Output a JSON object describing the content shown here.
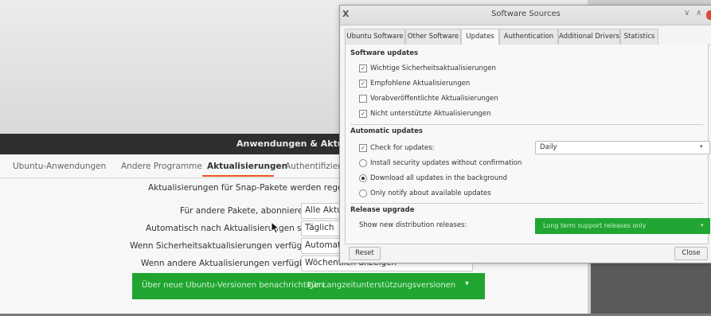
{
  "background_window": {
    "title": "Anwendungen & Aktualisierungen",
    "tabs": [
      "Ubuntu-Anwendungen",
      "Andere Programme",
      "Aktualisierungen",
      "Authentifizierung"
    ],
    "snap_note": "Aktualisierungen für Snap-Pakete werden regelmäßig geprüft",
    "rows": [
      {
        "label": "Für andere Pakete, abonnieren Sie:",
        "value": "Alle Aktualisierungen"
      },
      {
        "label": "Automatisch nach Aktualisierungen suchen:",
        "value": "Täglich"
      },
      {
        "label": "Wenn Sicherheitsaktualisierungen verfügbar sind:",
        "value": "Automatisch herunterladen"
      },
      {
        "label": "Wenn andere Aktualisierungen verfügbar sind:",
        "value": "Wöchentlich anzeigen"
      }
    ],
    "release_row": {
      "label": "Über neue Ubuntu-Versionen benachrichtigen:",
      "value": "Für Langzeitunterstützungsversionen",
      "color": "#1fa530"
    }
  },
  "dialog": {
    "title": "Software Sources",
    "tabs": [
      "Ubuntu Software",
      "Other Software",
      "Updates",
      "Authentication",
      "Additional Drivers",
      "Statistics"
    ],
    "active_tab": "Updates",
    "software_updates": {
      "heading": "Software updates",
      "items": [
        {
          "label": "Wichtige Sicherheitsaktualisierungen",
          "checked": true,
          "check": "✓"
        },
        {
          "label": "Empfohlene Aktualisierungen",
          "checked": true,
          "check": "✓"
        },
        {
          "label": "Vorabveröffentlichte Aktualisierungen",
          "checked": false,
          "check": ""
        },
        {
          "label": "Nicht unterstützte Aktualisierungen",
          "checked": true,
          "check": "✓"
        }
      ]
    },
    "automatic_updates": {
      "heading": "Automatic updates",
      "check_label": "Check for updates:",
      "check_mark": "✓",
      "interval": "Daily",
      "options": [
        {
          "label": "Install security updates without confirmation",
          "selected": false
        },
        {
          "label": "Download all updates in the background",
          "selected": true
        },
        {
          "label": "Only notify about available updates",
          "selected": false
        }
      ]
    },
    "release_upgrade": {
      "heading": "Release upgrade",
      "label": "Show new distribution releases:",
      "value": "Long term support releases only",
      "color": "#21a634"
    },
    "buttons": {
      "reset": "Reset",
      "close": "Close"
    },
    "window_controls": {
      "app_icon": "X",
      "minimize": "∨",
      "maximize": "∧"
    }
  }
}
